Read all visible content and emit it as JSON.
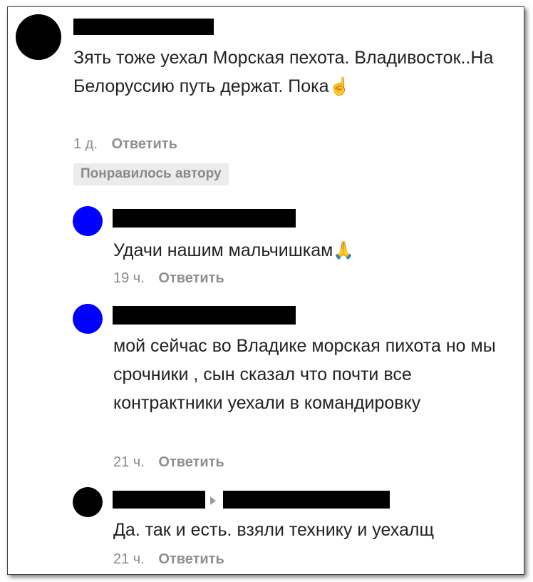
{
  "comments": [
    {
      "text": "Зять тоже уехал Морская пехота. Владивосток..На Белоруссию путь держат. Пока",
      "emoji": "☝️",
      "time": "1 д.",
      "reply": "Ответить",
      "badge": "Понравилось автору",
      "avatar_color": "#000000"
    },
    {
      "text": "Удачи нашим мальчишкам",
      "emoji": "🙏",
      "time": "19 ч.",
      "reply": "Ответить",
      "avatar_color": "#0000ff"
    },
    {
      "text": "мой сейчас во Владике морская пихота но мы срочники , сын сказал что почти все контрактники уехали в командировку",
      "time": "21 ч.",
      "reply": "Ответить",
      "avatar_color": "#0000ff"
    },
    {
      "text": "Да. так и есть. взяли технику и уехалщ",
      "time": "21 ч.",
      "reply": "Ответить",
      "avatar_color": "#000000",
      "reply_arrow_icon": "caret-right-icon"
    }
  ]
}
